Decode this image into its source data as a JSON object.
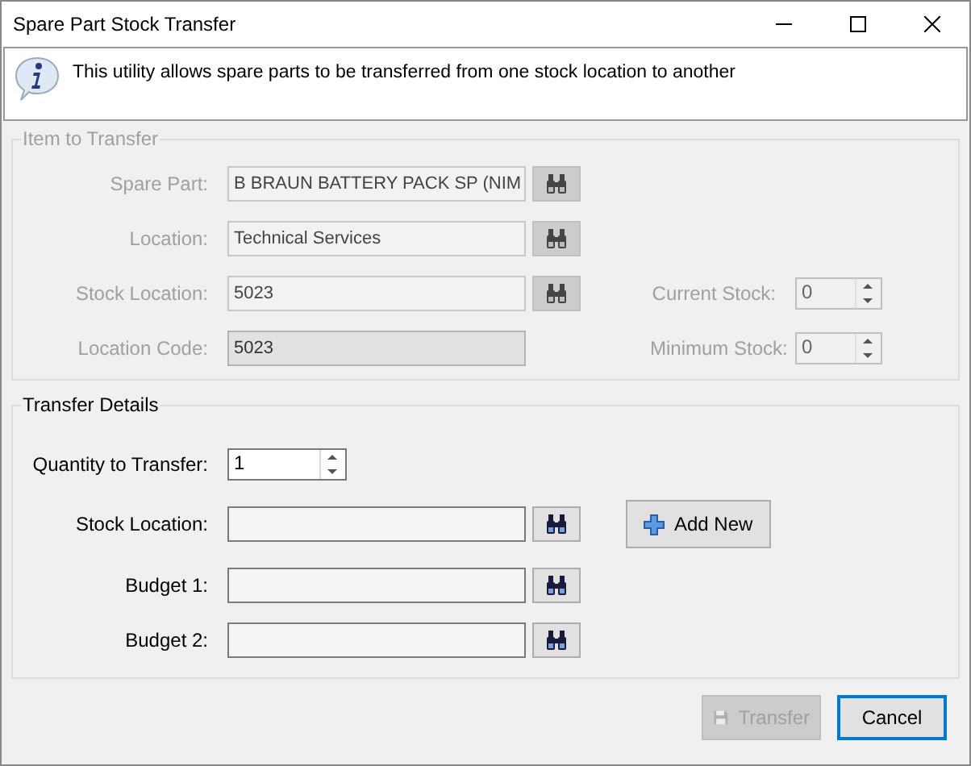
{
  "window": {
    "title": "Spare Part Stock Transfer"
  },
  "info": {
    "message": "This utility allows spare parts to be transferred from one stock location to another"
  },
  "item_group": {
    "title": "Item to Transfer",
    "disabled": true,
    "fields": [
      {
        "label": "Spare Part:",
        "value": "B BRAUN BATTERY PACK SP (NIM",
        "lookup": true
      },
      {
        "label": "Location:",
        "value": "Technical Services",
        "lookup": true
      },
      {
        "label": "Stock Location:",
        "value": "5023",
        "lookup": true
      },
      {
        "label": "Location Code:",
        "value": "5023",
        "lookup": false
      }
    ],
    "side_fields": [
      {
        "label": "Current Stock:",
        "value": "0"
      },
      {
        "label": "Minimum Stock:",
        "value": "0"
      }
    ]
  },
  "transfer_group": {
    "title": "Transfer Details",
    "disabled": false,
    "quantity": {
      "label": "Quantity to Transfer:",
      "value": "1"
    },
    "fields": [
      {
        "label": "Stock Location:",
        "lookup": true
      },
      {
        "label": "Budget 1:",
        "lookup": true
      },
      {
        "label": "Budget 2:",
        "lookup": true
      }
    ],
    "add_button": "Add New"
  },
  "buttons": [
    {
      "label": "Transfer",
      "disabled": true,
      "focused": false
    },
    {
      "label": "Cancel",
      "disabled": false,
      "focused": true
    }
  ]
}
